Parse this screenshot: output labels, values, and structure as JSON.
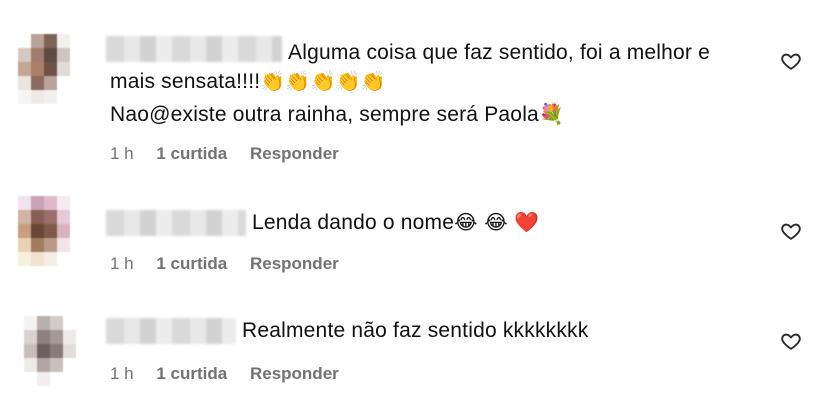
{
  "comments": [
    {
      "lines": [
        "Alguma coisa que faz sentido, foi a melhor e",
        "mais sensata!!!!",
        "Nao@existe outra rainha, sempre será Paola"
      ],
      "line2_emoji": "👏👏👏👏👏",
      "line3_emoji": "💐",
      "time": "1 h",
      "likes": "1 curtida",
      "reply": "Responder",
      "avatar_colors": [
        "#ffffff",
        "#b9a29a",
        "#7e6358",
        "#f2efed",
        "#d8c6c0",
        "#a07c6e",
        "#5e4a43",
        "#cfc4c0",
        "#c4a596",
        "#ab7e67",
        "#6f5148",
        "#e1dbd8",
        "#ebe4e1",
        "#8b6b60",
        "#b8a39b",
        "#ffffff",
        "#f7f5f4",
        "#efe9e7",
        "#f3efee",
        "#ffffff"
      ]
    },
    {
      "text": "Lenda dando o nome",
      "emoji": "😂 😂 ❤️",
      "time": "1 h",
      "likes": "1 curtida",
      "reply": "Responder",
      "avatar_colors": [
        "#f0e2ee",
        "#c7a3b5",
        "#dfb9c9",
        "#f5eaf1",
        "#d1b3a6",
        "#8a5f53",
        "#9b6f6a",
        "#e5c9d7",
        "#c89d80",
        "#6b4636",
        "#7f5a49",
        "#d9b2c2",
        "#e9d2b3",
        "#a07c60",
        "#b89a85",
        "#f2e3ea",
        "#f6eede",
        "#efe2cf",
        "#f5ece6",
        "#ffffff"
      ]
    },
    {
      "text": "Realmente não faz sentido kkkkkkkk",
      "time": "1 h",
      "likes": "1 curtida",
      "reply": "Responder",
      "avatar_colors": [
        "#f4f2f2",
        "#b9afad",
        "#d3cbc9",
        "#ffffff",
        "#d9d1cf",
        "#8e807e",
        "#a69894",
        "#efeaea",
        "#c8bdbb",
        "#6e605e",
        "#8a7b78",
        "#e3dddc",
        "#eeeaea",
        "#b2a6a4",
        "#c9bfbd",
        "#ffffff",
        "#ffffff",
        "#f2eeee",
        "#ffffff",
        "#ffffff"
      ]
    }
  ]
}
